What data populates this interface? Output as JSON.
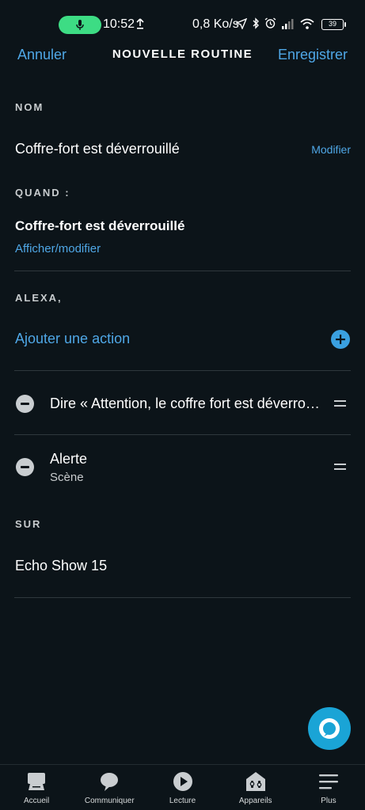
{
  "status_bar": {
    "time": "10:52",
    "network_speed": "0,8 Ko/s",
    "battery": "39"
  },
  "header": {
    "cancel_label": "Annuler",
    "title": "NOUVELLE ROUTINE",
    "save_label": "Enregistrer"
  },
  "name_section": {
    "label": "NOM",
    "value": "Coffre-fort est déverrouillé",
    "edit_label": "Modifier"
  },
  "when_section": {
    "label": "QUAND :",
    "trigger": "Coffre-fort est déverrouillé",
    "view_edit_label": "Afficher/modifier"
  },
  "alexa_section": {
    "label": "ALEXA,",
    "add_action_label": "Ajouter une action",
    "actions": [
      {
        "title": "Dire « Attention, le coffre fort est déverrouillé »",
        "subtitle": ""
      },
      {
        "title": "Alerte",
        "subtitle": "Scène"
      }
    ]
  },
  "on_section": {
    "label": "SUR",
    "device": "Echo Show  15"
  },
  "bottom_nav": {
    "items": [
      {
        "label": "Accueil",
        "icon": "home-icon"
      },
      {
        "label": "Communiquer",
        "icon": "chat-bubble-icon"
      },
      {
        "label": "Lecture",
        "icon": "play-icon"
      },
      {
        "label": "Appareils",
        "icon": "devices-icon"
      },
      {
        "label": "Plus",
        "icon": "menu-icon"
      }
    ]
  },
  "colors": {
    "background": "#0c1419",
    "accent": "#4fa7e6",
    "alexa": "#1aa4d6",
    "divider": "#2f383d"
  }
}
